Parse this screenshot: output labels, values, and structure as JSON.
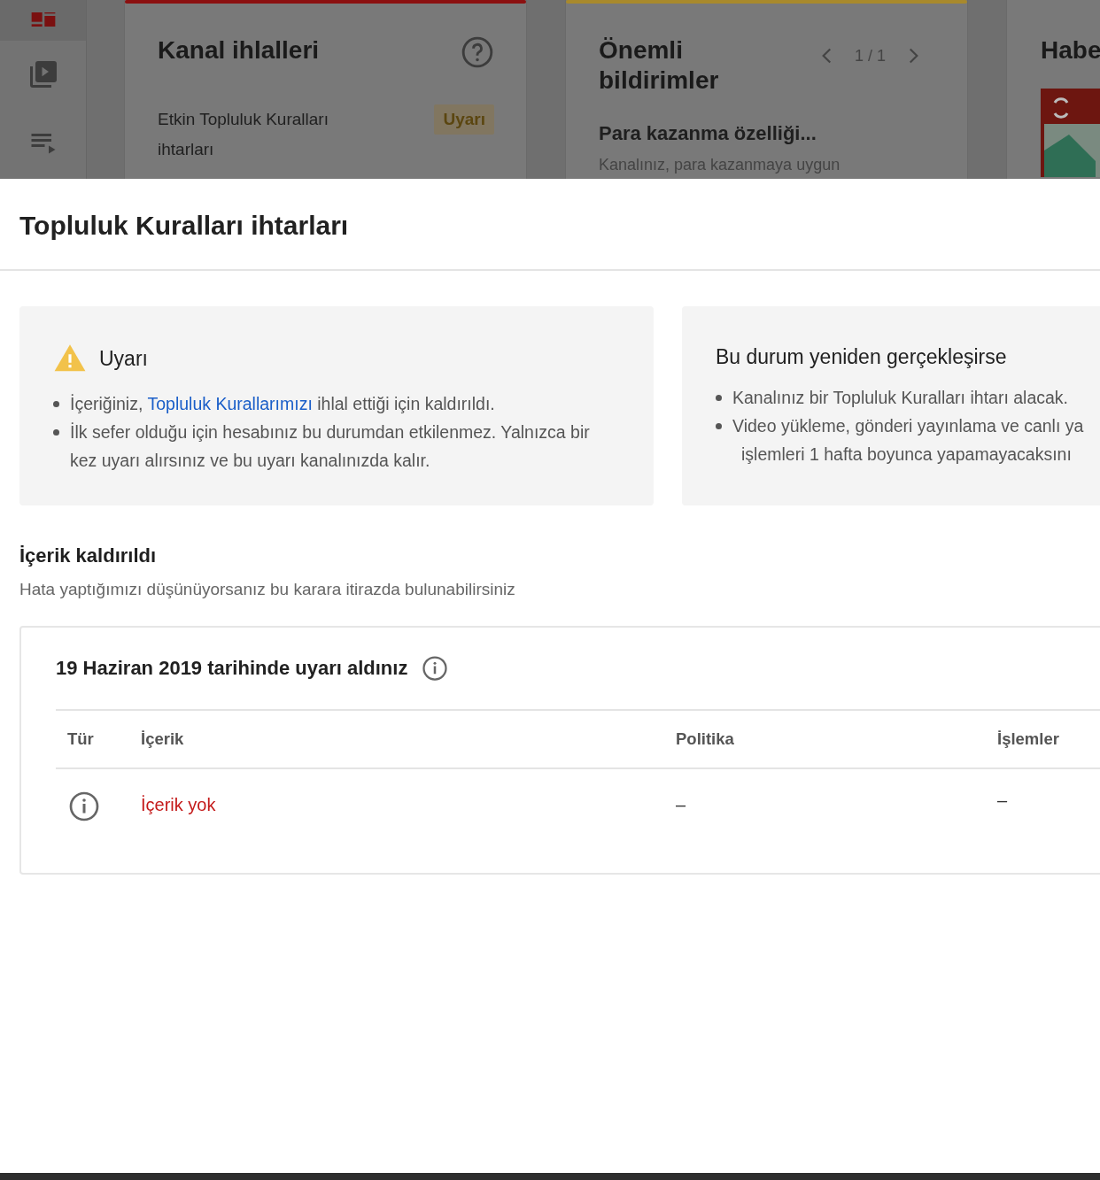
{
  "background": {
    "sidebar": {
      "items": [
        {
          "kind": "dashboard",
          "selected": true
        },
        {
          "kind": "videos",
          "selected": false
        },
        {
          "kind": "playlists",
          "selected": false
        }
      ]
    },
    "cards": [
      {
        "kind": "violations",
        "color": "#8b1010",
        "title": "Kanal ihlalleri",
        "row_label": "Etkin Topluluk Kuralları ihtarları",
        "badge": "Uyarı"
      },
      {
        "kind": "notices",
        "color": "#a8892c",
        "title": "Önemli bildirimler",
        "pager": "1 / 1",
        "item_title": "Para kazanma özelliği...",
        "item_text": "Kanalınız, para kazanmaya uygun"
      },
      {
        "kind": "news",
        "title": "Habe"
      }
    ]
  },
  "sheet": {
    "title": "Topluluk Kuralları ihtarları",
    "info_boxes": [
      {
        "kind": "warning",
        "title": "Uyarı",
        "bullets": [
          {
            "lines": [
              "İçeriğiniz, "
            ],
            "link": "Topluluk Kurallarımızı",
            "after_link": " ihlal ettiği için kaldırıldı."
          },
          {
            "lines": [
              "İlk sefer olduğu için hesabınız bu durumdan etkilenmez. Yalnızca bir kez uyarı alırsınız ve bu uyarı kanalınızda kalır."
            ]
          }
        ]
      },
      {
        "kind": "plain",
        "title": "Bu durum yeniden gerçekleşirse",
        "bullets": [
          {
            "lines": [
              "Kanalınız bir Topluluk Kuralları ihtarı alacak."
            ]
          },
          {
            "lines": [
              "Video yükleme, gönderi yayınlama ve canlı ya",
              "işlemleri 1 hafta boyunca yapamayacaksını"
            ]
          }
        ]
      }
    ],
    "section_title": "İçerik kaldırıldı",
    "section_subtitle": "Hata yaptığımızı düşünüyorsanız bu karara itirazda bulunabilirsiniz",
    "strike": {
      "heading": "19 Haziran 2019 tarihinde uyarı aldınız",
      "table": {
        "columns": [
          "Tür",
          "İçerik",
          "Politika",
          "İşlemler"
        ],
        "rows": [
          {
            "content": "İçerik yok",
            "policy": "–",
            "actions": "–"
          }
        ]
      }
    }
  }
}
